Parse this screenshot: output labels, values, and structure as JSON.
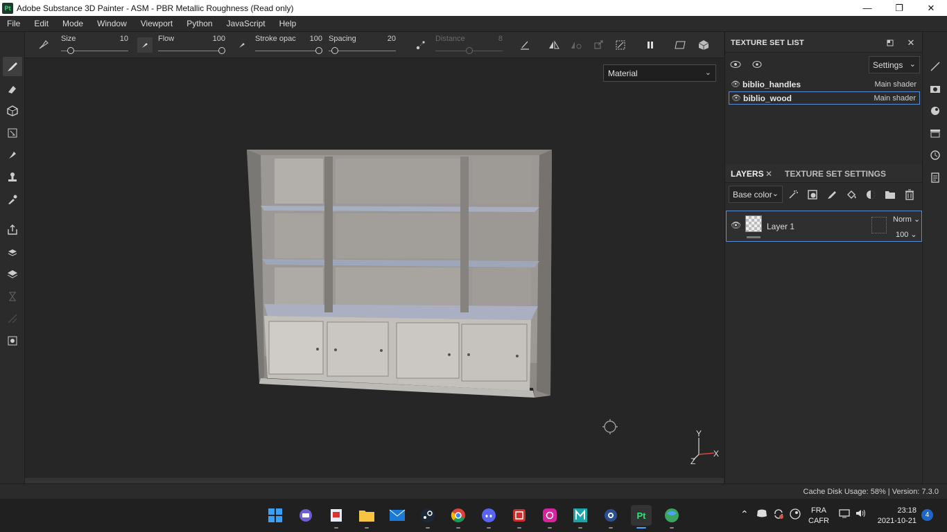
{
  "window": {
    "app_icon_label": "Pt",
    "title": "Adobe Substance 3D Painter - ASM - PBR Metallic Roughness (Read only)",
    "minimize": "—",
    "maximize": "❐",
    "close": "✕"
  },
  "menu": [
    "File",
    "Edit",
    "Mode",
    "Window",
    "Viewport",
    "Python",
    "JavaScript",
    "Help"
  ],
  "tool_options": {
    "size": {
      "label": "Size",
      "value": "10",
      "level": 0.1
    },
    "flow": {
      "label": "Flow",
      "value": "100",
      "level": 1.0
    },
    "stroke_opacity": {
      "label": "Stroke opac",
      "value": "100",
      "level": 1.0
    },
    "spacing": {
      "label": "Spacing",
      "value": "20",
      "level": 0.05
    },
    "distance": {
      "label": "Distance",
      "value": "8",
      "level": 0.5
    }
  },
  "viewport": {
    "material_mode": "Material",
    "axis_y": "Y",
    "axis_x": "X",
    "axis_z": "Z"
  },
  "texture_set_list": {
    "title": "TEXTURE SET LIST",
    "settings_label": "Settings",
    "items": [
      {
        "name": "biblio_handles",
        "shader": "Main shader",
        "selected": false
      },
      {
        "name": "biblio_wood",
        "shader": "Main shader",
        "selected": true
      }
    ]
  },
  "layers": {
    "tab_layers": "LAYERS",
    "tab_texture_set_settings": "TEXTURE SET SETTINGS",
    "channel": "Base color",
    "items": [
      {
        "name": "Layer 1",
        "blend": "Norm",
        "opacity": "100"
      }
    ]
  },
  "status": {
    "text": "Cache Disk Usage:   58% | Version: 7.3.0"
  },
  "taskbar": {
    "apps": [
      "Start",
      "Teams",
      "Snip",
      "Explorer",
      "Mail",
      "Steam",
      "Chrome",
      "Discord",
      "Security",
      "Instagram",
      "Maya",
      "Blender",
      "Substance Painter",
      "Browser"
    ],
    "active_app": "Pt",
    "lang_line1": "FRA",
    "lang_line2": "CAFR",
    "time": "23:18",
    "date": "2021-10-21",
    "notifications": "4"
  }
}
